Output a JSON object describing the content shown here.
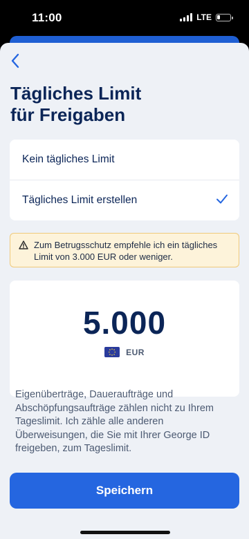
{
  "status_bar": {
    "time": "11:00",
    "network": "LTE"
  },
  "header": {
    "title_line1": "Tägliches Limit",
    "title_line2": "für Freigaben"
  },
  "options": [
    {
      "label": "Kein tägliches Limit",
      "selected": false
    },
    {
      "label": "Tägliches Limit erstellen",
      "selected": true
    }
  ],
  "warning": {
    "text": "Zum Betrugsschutz empfehle ich ein tägliches Limit von 3.000 EUR oder weniger."
  },
  "amount": {
    "value": "5.000",
    "currency": "EUR"
  },
  "info": {
    "text": "Eigenüberträge, Daueraufträge und Abschöpfungsaufträge zählen nicht zu Ihrem Tageslimit. Ich zähle alle anderen Überweisungen, die Sie mit Ihrer George ID freigeben, zum Tageslimit."
  },
  "footer": {
    "save_label": "Speichern"
  },
  "colors": {
    "primary": "#2566e0",
    "title": "#0b2557",
    "warning_bg": "#fdf3da",
    "warning_border": "#efc97a"
  },
  "icons": {
    "back": "chevron-left-icon",
    "check": "check-icon",
    "warning": "warning-icon",
    "flag": "eu-flag-icon"
  }
}
